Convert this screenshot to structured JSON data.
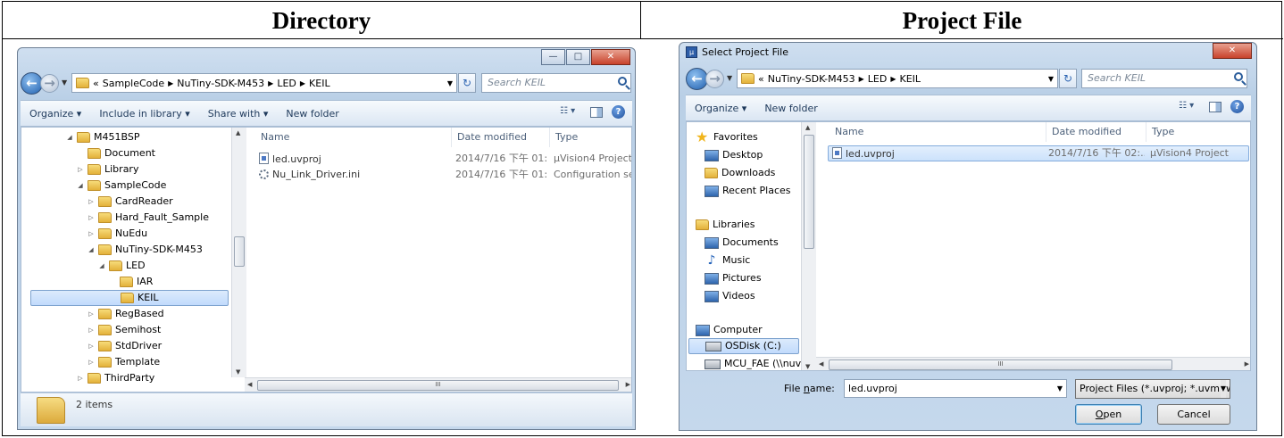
{
  "table": {
    "left_header": "Directory",
    "right_header": "Project File"
  },
  "explorer": {
    "breadcrumb_prefix": "«",
    "breadcrumb": [
      "SampleCode",
      "NuTiny-SDK-M453",
      "LED",
      "KEIL"
    ],
    "search_placeholder": "Search KEIL",
    "toolbar": [
      "Organize ▾",
      "Include in library ▾",
      "Share with ▾",
      "New folder"
    ],
    "tree": [
      {
        "label": "M451BSP",
        "expander": "◢",
        "level": 0
      },
      {
        "label": "Document",
        "expander": "",
        "level": 1
      },
      {
        "label": "Library",
        "expander": "▷",
        "level": 1
      },
      {
        "label": "SampleCode",
        "expander": "◢",
        "level": 1
      },
      {
        "label": "CardReader",
        "expander": "▷",
        "level": 2
      },
      {
        "label": "Hard_Fault_Sample",
        "expander": "▷",
        "level": 2
      },
      {
        "label": "NuEdu",
        "expander": "▷",
        "level": 2
      },
      {
        "label": "NuTiny-SDK-M453",
        "expander": "◢",
        "level": 2
      },
      {
        "label": "LED",
        "expander": "◢",
        "level": 3
      },
      {
        "label": "IAR",
        "expander": "",
        "level": 4
      },
      {
        "label": "KEIL",
        "expander": "",
        "level": 4,
        "selected": true
      },
      {
        "label": "RegBased",
        "expander": "▷",
        "level": 2
      },
      {
        "label": "Semihost",
        "expander": "▷",
        "level": 2
      },
      {
        "label": "StdDriver",
        "expander": "▷",
        "level": 2
      },
      {
        "label": "Template",
        "expander": "▷",
        "level": 2
      },
      {
        "label": "ThirdParty",
        "expander": "▷",
        "level": 1
      }
    ],
    "columns": [
      "Name",
      "Date modified",
      "Type"
    ],
    "files": [
      {
        "name": "led.uvproj",
        "date": "2014/7/16 下午 01:...",
        "type": "µVision4 Project"
      },
      {
        "name": "Nu_Link_Driver.ini",
        "date": "2014/7/16 下午 01:...",
        "type": "Configuration sett"
      }
    ],
    "status": "2 items",
    "scroll_marker": "III"
  },
  "dialog": {
    "title": "Select Project File",
    "breadcrumb_prefix": "«",
    "breadcrumb": [
      "NuTiny-SDK-M453",
      "LED",
      "KEIL"
    ],
    "search_placeholder": "Search KEIL",
    "toolbar": [
      "Organize ▾",
      "New folder"
    ],
    "nav": [
      {
        "label": "Favorites",
        "icon": "star-icon",
        "group": true
      },
      {
        "label": "Desktop",
        "icon": "desktop-icon"
      },
      {
        "label": "Downloads",
        "icon": "downloads-icon"
      },
      {
        "label": "Recent Places",
        "icon": "recent-places-icon"
      },
      {
        "label": "Libraries",
        "icon": "libraries-icon",
        "group": true
      },
      {
        "label": "Documents",
        "icon": "documents-icon"
      },
      {
        "label": "Music",
        "icon": "music-icon"
      },
      {
        "label": "Pictures",
        "icon": "pictures-icon"
      },
      {
        "label": "Videos",
        "icon": "videos-icon"
      },
      {
        "label": "Computer",
        "icon": "computer-icon",
        "group": true
      },
      {
        "label": "OSDisk (C:)",
        "icon": "disk-icon",
        "selected": true
      },
      {
        "label": "MCU_FAE (\\\\nuv ▾",
        "icon": "network-drive-icon"
      }
    ],
    "columns": [
      "Name",
      "Date modified",
      "Type"
    ],
    "files": [
      {
        "name": "led.uvproj",
        "date": "2014/7/16 下午 02:...",
        "type": "µVision4 Project"
      }
    ],
    "filename_label_pre": "File ",
    "filename_label_u": "n",
    "filename_label_post": "ame:",
    "filename_value": "led.uvproj",
    "filter": "Project Files (*.uvproj; *.uvmpw",
    "open_u": "O",
    "open_rest": "pen",
    "cancel": "Cancel",
    "scroll_marker": "III"
  }
}
